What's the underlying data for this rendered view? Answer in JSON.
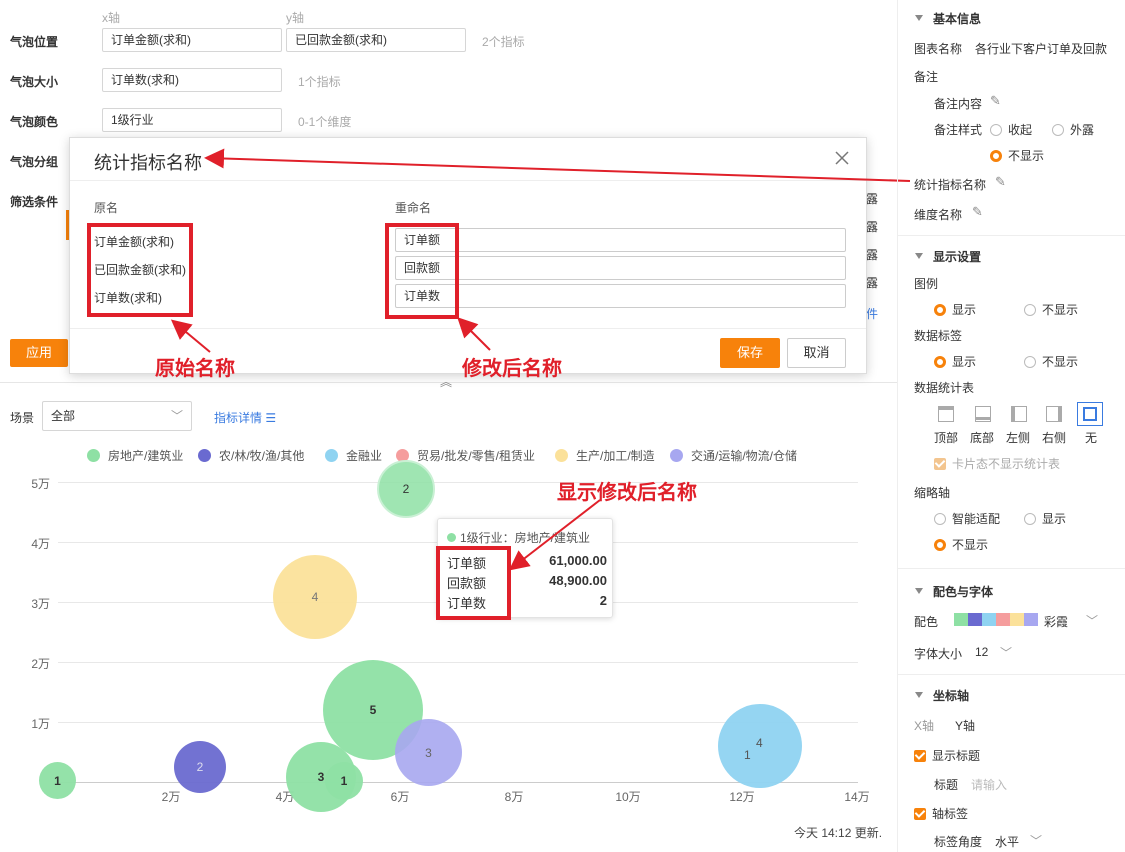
{
  "config": {
    "x_axis_label": "x轴",
    "y_axis_label": "y轴",
    "rows": [
      {
        "label": "气泡位置",
        "field1": "订单金额(求和)",
        "field2": "已回款金额(求和)",
        "hint": "2个指标"
      },
      {
        "label": "气泡大小",
        "field1": "订单数(求和)",
        "hint": "1个指标"
      },
      {
        "label": "气泡颜色",
        "field1": "1级行业",
        "hint": "0-1个维度"
      },
      {
        "label": "气泡分组"
      },
      {
        "label": "筛选条件"
      }
    ],
    "apply_label": "应用",
    "link_suffix": "件",
    "behind_labels": [
      "露",
      "露",
      "露",
      "露"
    ]
  },
  "dialog": {
    "title": "统计指标名称",
    "col_original": "原名",
    "col_rename": "重命名",
    "rows": [
      {
        "original": "订单金额(求和)",
        "rename": "订单额"
      },
      {
        "original": "已回款金额(求和)",
        "rename": "回款额"
      },
      {
        "original": "订单数(求和)",
        "rename": "订单数"
      }
    ],
    "save_label": "保存",
    "cancel_label": "取消"
  },
  "annotations": {
    "original_name": "原始名称",
    "modified_name": "修改后名称",
    "show_modified": "显示修改后名称"
  },
  "chart_toolbar": {
    "scene_label": "场景",
    "scene_value": "全部",
    "metric_details": "指标详情"
  },
  "legend": [
    {
      "name": "房地产/建筑业",
      "color": "#8ee0a4"
    },
    {
      "name": "农/林/牧/渔/其他",
      "color": "#6a6ad0"
    },
    {
      "name": "金融业",
      "color": "#8fd3f1"
    },
    {
      "name": "贸易/批发/零售/租赁业",
      "color": "#f59d9d"
    },
    {
      "name": "生产/加工/制造",
      "color": "#fbe19a"
    },
    {
      "name": "交通/运输/物流/仓储",
      "color": "#a7a7f0"
    }
  ],
  "tooltip": {
    "header": "1级行业：房地产/建筑业",
    "rows": [
      {
        "label": "订单额",
        "value": "61,000.00"
      },
      {
        "label": "回款额",
        "value": "48,900.00"
      },
      {
        "label": "订单数",
        "value": "2"
      }
    ]
  },
  "chart_data": {
    "type": "scatter",
    "x_ticks": [
      "2万",
      "4万",
      "6万",
      "8万",
      "10万",
      "12万",
      "14万"
    ],
    "y_ticks": [
      "1万",
      "2万",
      "3万",
      "4万",
      "5万"
    ],
    "xlim": [
      0,
      140000
    ],
    "ylim": [
      0,
      50000
    ],
    "points": [
      {
        "series": "房地产/建筑业",
        "x": 0,
        "y": 0,
        "size": 1,
        "label": "1"
      },
      {
        "series": "农/林/牧/渔/其他",
        "x": 25000,
        "y": 2500,
        "size": 2,
        "label": "2"
      },
      {
        "series": "房地产/建筑业",
        "x": 61000,
        "y": 48900,
        "size": 2,
        "label": "2"
      },
      {
        "series": "生产/加工/制造",
        "x": 45000,
        "y": 31000,
        "size": 4,
        "label": "4"
      },
      {
        "series": "房地产/建筑业",
        "x": 55000,
        "y": 12000,
        "size": 5,
        "label": "5"
      },
      {
        "series": "交通/运输/物流/仓储",
        "x": 67000,
        "y": 5000,
        "size": 3,
        "label": "3"
      },
      {
        "series": "房地产/建筑业",
        "x": 47000,
        "y": 800,
        "size": 3,
        "label": "3"
      },
      {
        "series": "房地产/建筑业",
        "x": 52000,
        "y": 0,
        "size": 1,
        "label": "1"
      },
      {
        "series": "金融业",
        "x": 125000,
        "y": 6000,
        "size": 4,
        "label": "4"
      },
      {
        "series": "金融业",
        "x": 123000,
        "y": 4500,
        "size": 1,
        "label": "1"
      }
    ]
  },
  "footer": {
    "updated": "今天 14:12 更新."
  },
  "right_panel": {
    "basic_info": "基本信息",
    "chart_name_label": "图表名称",
    "chart_name_value": "各行业下客户订单及回款",
    "note_label": "备注",
    "note_content_label": "备注内容",
    "note_style_label": "备注样式",
    "note_style_options": [
      "收起",
      "外露",
      "不显示"
    ],
    "metric_name_label": "统计指标名称",
    "dim_name_label": "维度名称",
    "display_settings": "显示设置",
    "legend_label": "图例",
    "show": "显示",
    "hide": "不显示",
    "data_label_label": "数据标签",
    "data_table_label": "数据统计表",
    "table_positions": [
      "顶部",
      "底部",
      "左侧",
      "右侧",
      "无"
    ],
    "card_hide_label": "卡片态不显示统计表",
    "thumb_axis_label": "缩略轴",
    "thumb_axis_options": [
      "智能适配",
      "显示",
      "不显示"
    ],
    "color_font": "配色与字体",
    "color_label": "配色",
    "color_scheme": "彩霞",
    "palette": [
      "#8ee0a4",
      "#6a6ad0",
      "#8fd3f1",
      "#f59d9d",
      "#fbe19a",
      "#a7a7f0"
    ],
    "font_size_label": "字体大小",
    "font_size_value": "12",
    "axis_section": "坐标轴",
    "x_axis": "X轴",
    "y_axis": "Y轴",
    "show_title": "显示标题",
    "title_label": "标题",
    "title_placeholder": "请输入",
    "axis_ticks": "轴标签",
    "tick_angle_label": "标签角度",
    "tick_angle_value": "水平"
  }
}
